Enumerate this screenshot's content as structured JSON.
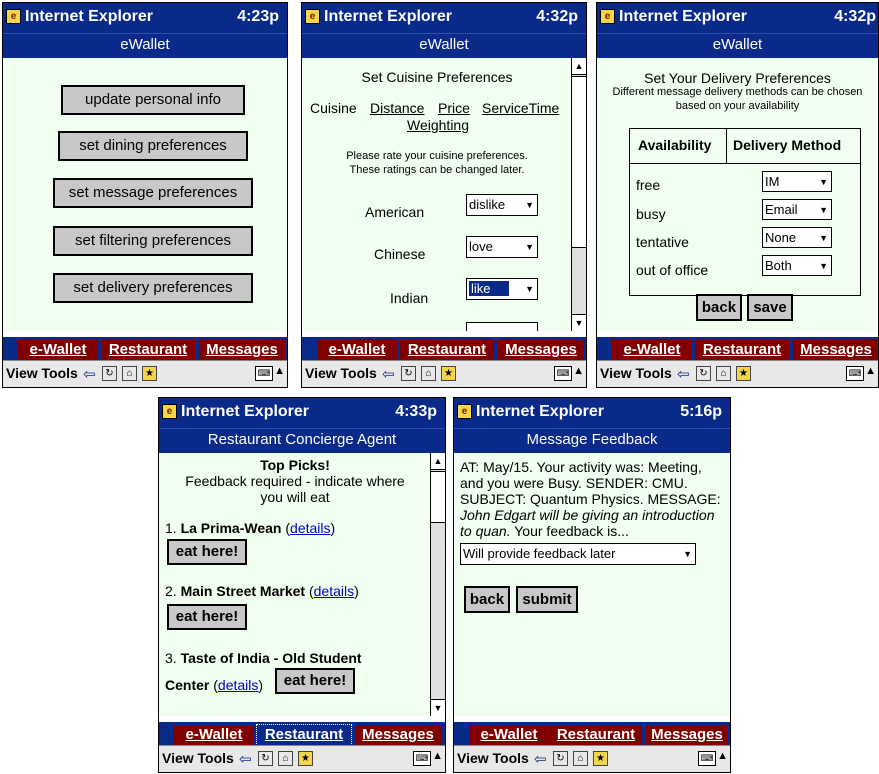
{
  "shared": {
    "app": "Internet Explorer",
    "nav_tabs": [
      "e-Wallet",
      "Restaurant",
      "Messages"
    ],
    "menu": "View Tools",
    "icons": [
      "back-arrow-icon",
      "refresh-icon",
      "home-icon",
      "favorites-icon",
      "keyboard-icon"
    ],
    "colors": {
      "title": "#0a2a8a",
      "tabs": "#800000",
      "content": "#f0fff0"
    }
  },
  "screen1": {
    "time": "4:23p",
    "subtitle": "eWallet",
    "buttons": [
      "update personal info",
      "set dining preferences",
      "set message preferences",
      "set filtering preferences",
      "set delivery preferences"
    ]
  },
  "screen2": {
    "time": "4:32p",
    "subtitle": "eWallet",
    "heading": "Set Cuisine Preferences",
    "tabs_label": "Cuisine",
    "tab_links": [
      "Distance",
      "Price",
      "ServiceTime",
      "Weighting"
    ],
    "instructions": [
      "Please rate your cuisine preferences.",
      "These ratings can be changed later."
    ],
    "rows": [
      {
        "label": "American",
        "value": "dislike"
      },
      {
        "label": "Chinese",
        "value": "love"
      },
      {
        "label": "Indian",
        "value": "like"
      }
    ]
  },
  "screen3": {
    "time": "4:32p",
    "subtitle": "eWallet",
    "heading": "Set Your Delivery Preferences",
    "desc": [
      "Different message delivery methods can be chosen",
      "based on your availability"
    ],
    "col_headers": [
      "Availability",
      "Delivery Method"
    ],
    "rows": [
      {
        "label": "free",
        "value": "IM"
      },
      {
        "label": "busy",
        "value": "Email"
      },
      {
        "label": "tentative",
        "value": "None"
      },
      {
        "label": "out of office",
        "value": "Both"
      }
    ],
    "back": "back",
    "save": "save"
  },
  "screen4": {
    "time": "4:33p",
    "subtitle": "Restaurant Concierge Agent",
    "heading": "Top Picks!",
    "desc": [
      "Feedback required - indicate where",
      "you will eat"
    ],
    "picks": [
      {
        "num": "1.",
        "name": "La Prima-Wean",
        "details": "details"
      },
      {
        "num": "2.",
        "name": "Main Street Market",
        "details": "details"
      },
      {
        "num": "3.",
        "name": "Taste of India - Old Student",
        "name2": "Center",
        "details": "details"
      }
    ],
    "eat_label": "eat here!"
  },
  "screen5": {
    "time": "5:16p",
    "subtitle": "Message Feedback",
    "message_lines": [
      "AT: May/15. Your activity was: Meeting,",
      "and you were Busy. SENDER: CMU.",
      "SUBJECT: Quantum Physics. MESSAGE:"
    ],
    "italic_lines": [
      "John Edgart will be giving an introduction",
      "to quan."
    ],
    "italic_tail": " Your feedback is...",
    "feedback_value": "Will provide feedback later",
    "back": "back",
    "submit": "submit"
  }
}
